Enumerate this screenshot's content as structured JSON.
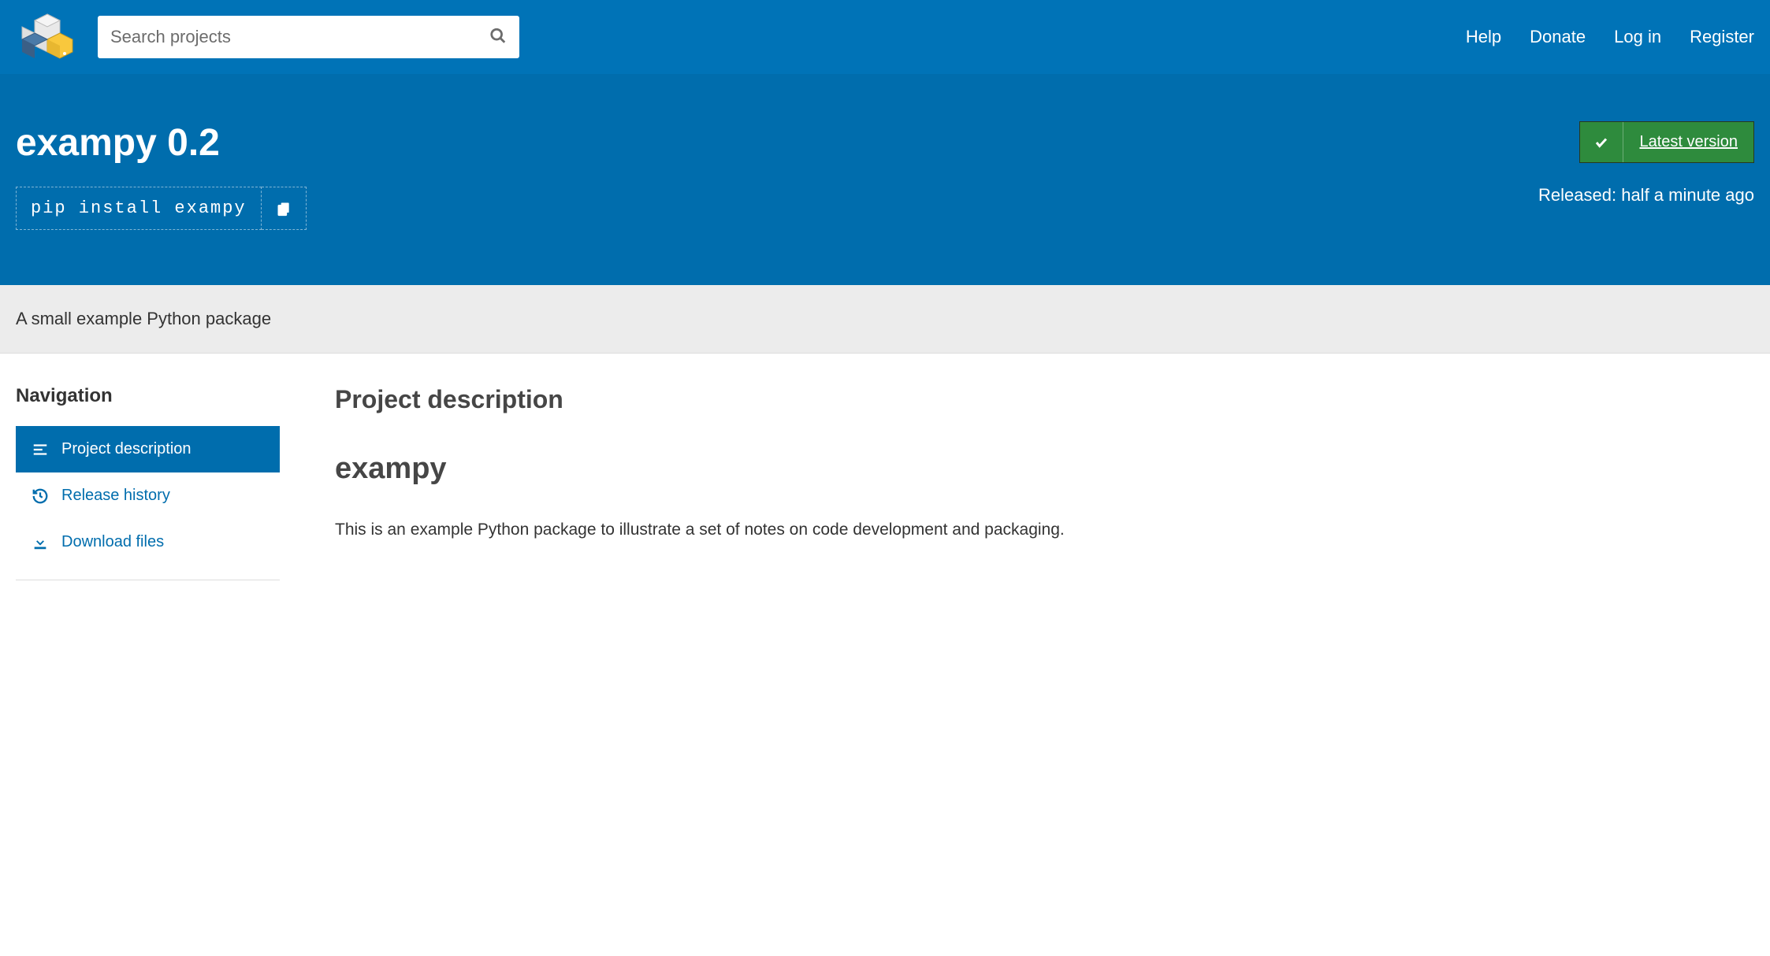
{
  "header": {
    "search_placeholder": "Search projects",
    "nav": {
      "help": "Help",
      "donate": "Donate",
      "login": "Log in",
      "register": "Register"
    }
  },
  "package": {
    "title": "exampy 0.2",
    "pip_command": "pip install exampy",
    "status_badge": "Latest version",
    "released": "Released: half a minute ago",
    "summary": "A small example Python package"
  },
  "sidebar": {
    "heading": "Navigation",
    "tabs": {
      "description": "Project description",
      "history": "Release history",
      "download": "Download files"
    }
  },
  "main": {
    "section_title": "Project description",
    "pkg_name": "exampy",
    "body": "This is an example Python package to illustrate a set of notes on code development and packaging."
  }
}
